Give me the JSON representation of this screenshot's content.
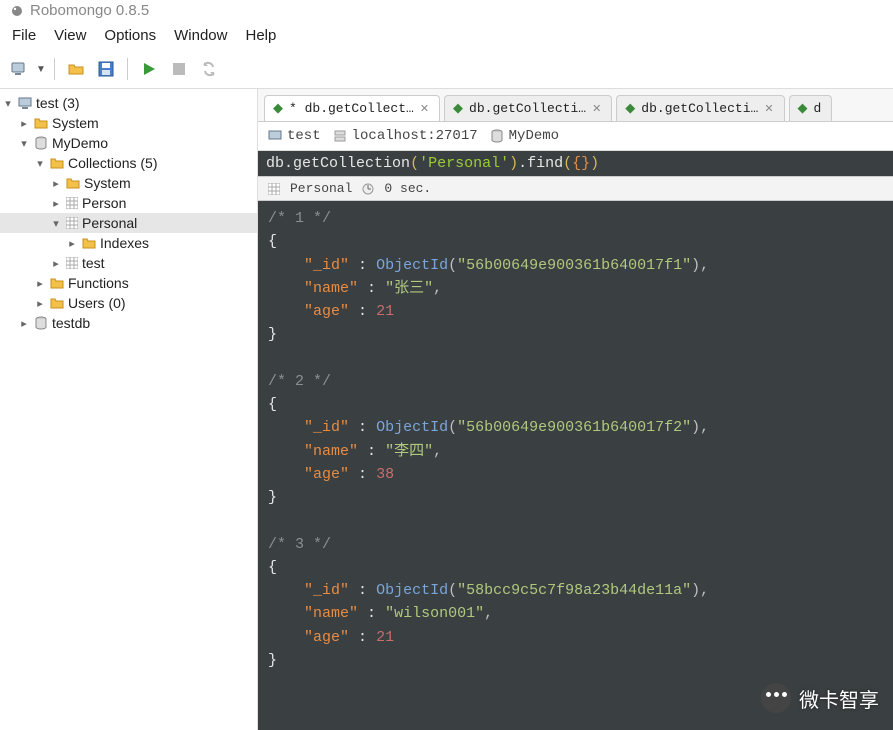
{
  "app": {
    "title": "Robomongo 0.8.5"
  },
  "menu": [
    "File",
    "View",
    "Options",
    "Window",
    "Help"
  ],
  "tree": {
    "root": {
      "label": "test (3)"
    },
    "system": {
      "label": "System"
    },
    "mydemo": {
      "label": "MyDemo"
    },
    "collections": {
      "label": "Collections (5)"
    },
    "coll_system": {
      "label": "System"
    },
    "coll_person": {
      "label": "Person"
    },
    "coll_personal": {
      "label": "Personal"
    },
    "coll_indexes": {
      "label": "Indexes"
    },
    "coll_test": {
      "label": "test"
    },
    "functions": {
      "label": "Functions"
    },
    "users": {
      "label": "Users (0)"
    },
    "testdb": {
      "label": "testdb"
    }
  },
  "tabs": [
    {
      "label": "* db.getCollect…",
      "active": true
    },
    {
      "label": "db.getCollecti…",
      "active": false
    },
    {
      "label": "db.getCollecti…",
      "active": false
    },
    {
      "label": "d",
      "active": false
    }
  ],
  "connection": {
    "conn": "test",
    "host": "localhost:27017",
    "db": "MyDemo"
  },
  "query": {
    "prefix": "db",
    "dot1": ".",
    "fn1": "getCollection",
    "open1": "(",
    "arg1": "'Personal'",
    "close1": ")",
    "dot2": ".",
    "fn2": "find",
    "open2": "(",
    "obj": "{}",
    "close2": ")"
  },
  "result_header": {
    "collection": "Personal",
    "time": "0 sec."
  },
  "documents": [
    {
      "num": 1,
      "_id": "56b00649e900361b640017f1",
      "name": "张三",
      "age": 21
    },
    {
      "num": 2,
      "_id": "56b00649e900361b640017f2",
      "name": "李四",
      "age": 38
    },
    {
      "num": 3,
      "_id": "58bcc9c5c7f98a23b44de11a",
      "name": "wilson001",
      "age": 21
    }
  ],
  "watermark": "微卡智享"
}
